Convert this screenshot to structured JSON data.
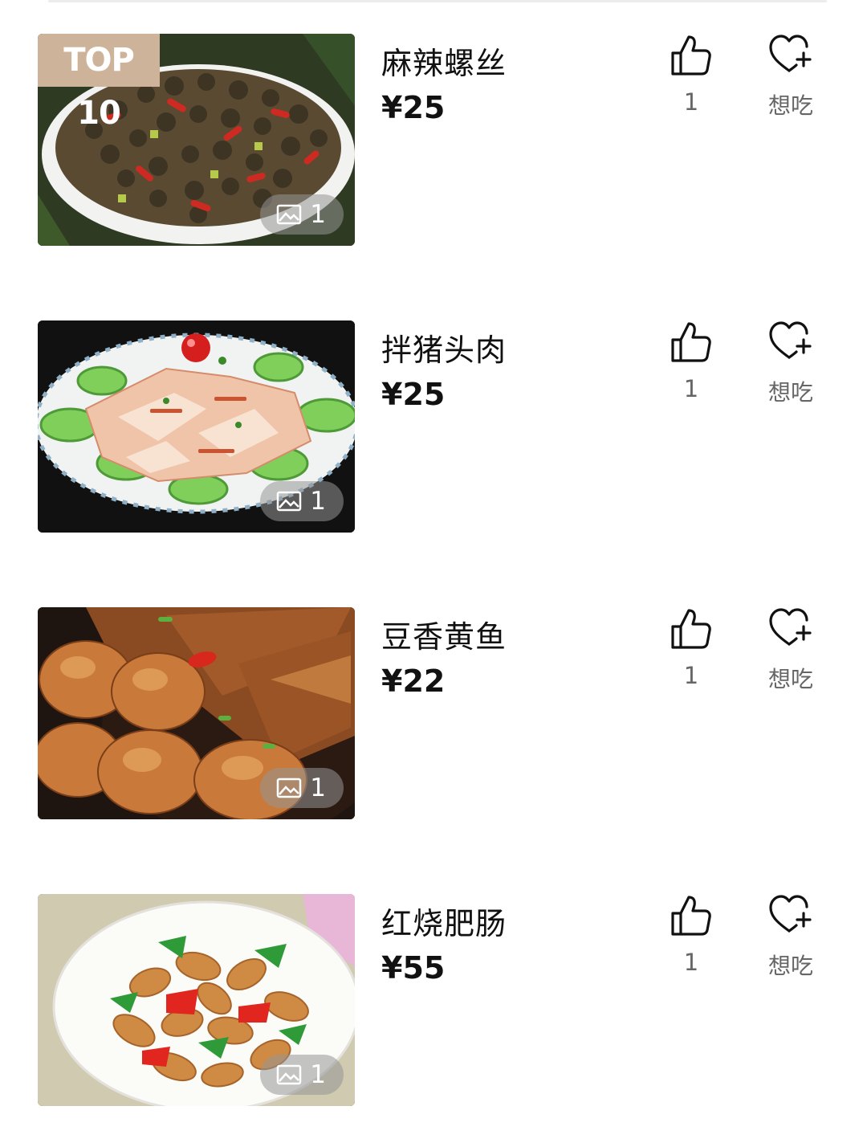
{
  "items": [
    {
      "title": "麻辣螺丝",
      "price": "¥25",
      "likes": "1",
      "want_label": "想吃",
      "image_count": "1",
      "badge": "TOP 10"
    },
    {
      "title": "拌猪头肉",
      "price": "¥25",
      "likes": "1",
      "want_label": "想吃",
      "image_count": "1"
    },
    {
      "title": "豆香黄鱼",
      "price": "¥22",
      "likes": "1",
      "want_label": "想吃",
      "image_count": "1"
    },
    {
      "title": "红烧肥肠",
      "price": "¥55",
      "likes": "1",
      "want_label": "想吃",
      "image_count": "1"
    }
  ],
  "icons": {
    "like": "thumbs-up-icon",
    "want": "heart-plus-icon",
    "image": "image-icon"
  },
  "colors": {
    "badge_bg": "#cdb39a",
    "secondary_text": "#666666",
    "primary_text": "#111111"
  }
}
